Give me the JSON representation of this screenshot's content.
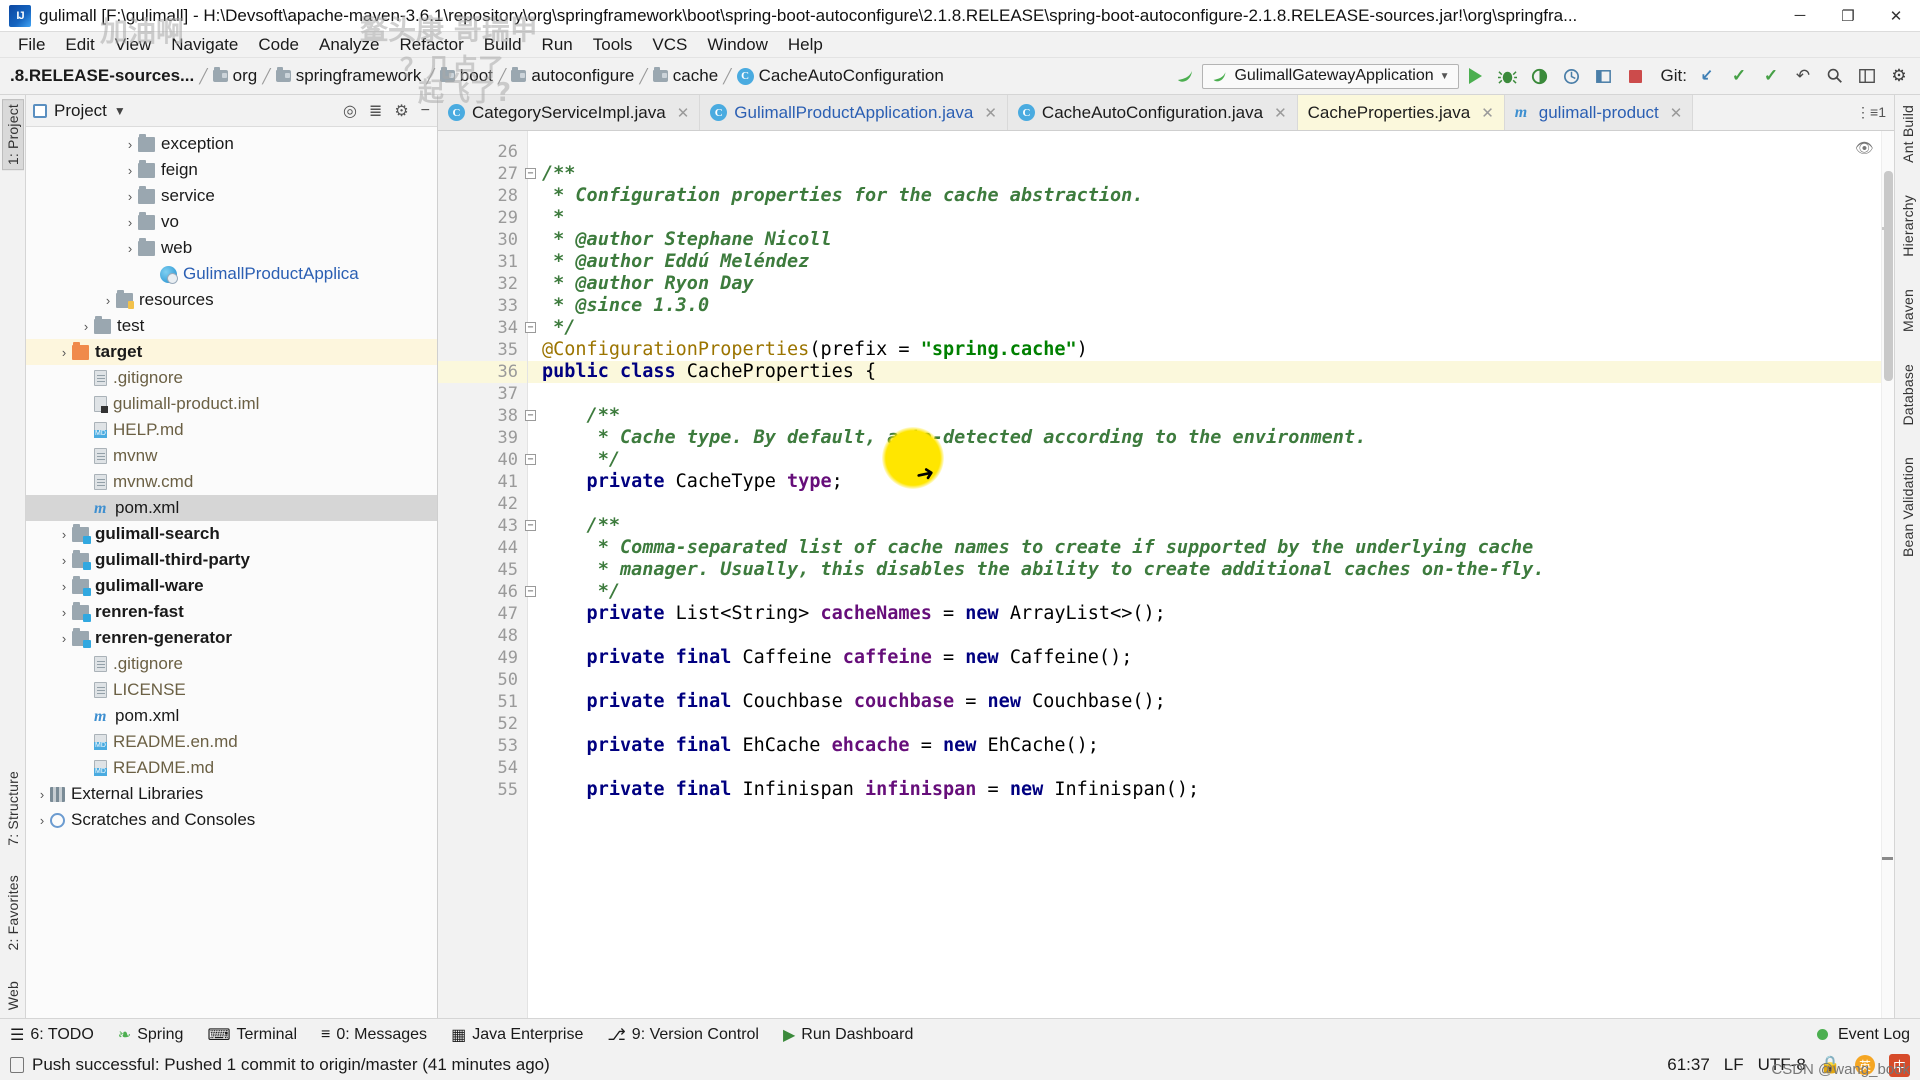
{
  "window": {
    "title": "gulimall [F:\\gulimall] - H:\\Devsoft\\apache-maven-3.6.1\\repository\\org\\springframework\\boot\\spring-boot-autoconfigure\\2.1.8.RELEASE\\spring-boot-autoconfigure-2.1.8.RELEASE-sources.jar!\\org\\springfra...",
    "logo": "IJ",
    "minimize": "─",
    "maximize": "❐",
    "close": "✕"
  },
  "menu": {
    "items": [
      "File",
      "Edit",
      "View",
      "Navigate",
      "Code",
      "Analyze",
      "Refactor",
      "Build",
      "Run",
      "Tools",
      "VCS",
      "Window",
      "Help"
    ]
  },
  "navbar": {
    "breadcrumbs": [
      {
        "label": ".8.RELEASE-sources...",
        "icon": "jar-icon",
        "type": "text"
      },
      {
        "label": "org",
        "icon": "folder-icon",
        "type": "folder"
      },
      {
        "label": "springframework",
        "icon": "folder-icon",
        "type": "folder"
      },
      {
        "label": "boot",
        "icon": "folder-icon",
        "type": "folder"
      },
      {
        "label": "autoconfigure",
        "icon": "folder-icon",
        "type": "folder"
      },
      {
        "label": "cache",
        "icon": "folder-icon",
        "type": "folder"
      },
      {
        "label": "CacheAutoConfiguration",
        "icon": "class-icon",
        "type": "class"
      }
    ],
    "run_config": "GulimallGatewayApplication",
    "run_config_icon": "spring-boot-icon",
    "dropdown_arrow": "▼",
    "buttons": [
      {
        "name": "run-button",
        "glyph": "▶"
      },
      {
        "name": "debug-button",
        "glyph": "🐞"
      },
      {
        "name": "run-with-coverage-button",
        "glyph": "◐"
      },
      {
        "name": "profile-button",
        "glyph": "⦿"
      },
      {
        "name": "attach-debugger-button",
        "glyph": "▤"
      },
      {
        "name": "stop-button",
        "glyph": "■"
      }
    ],
    "git_label": "Git:",
    "git_buttons": [
      {
        "name": "update-project-icon",
        "glyph": "↙"
      },
      {
        "name": "commit-icon",
        "glyph": "✓"
      },
      {
        "name": "push-icon",
        "glyph": "↗"
      },
      {
        "name": "history-icon",
        "glyph": "↺"
      },
      {
        "name": "search-everywhere-icon",
        "glyph": "⌕"
      },
      {
        "name": "settings-icon",
        "glyph": "⚙"
      },
      {
        "name": "project-structure-icon",
        "glyph": "▣"
      }
    ]
  },
  "left_rail": {
    "top": [
      {
        "label": "1: Project",
        "active": true
      }
    ],
    "bottom": [
      {
        "label": "7: Structure"
      },
      {
        "label": "2: Favorites"
      },
      {
        "label": "Web"
      }
    ]
  },
  "right_rail": {
    "items": [
      "Ant Build",
      "Hierarchy",
      "Maven",
      "Database",
      "Bean Validation"
    ]
  },
  "project_panel": {
    "title": "Project",
    "dropdown": "▼",
    "icons": [
      "target-icon",
      "collapse-all-icon",
      "settings-icon",
      "hide-icon"
    ],
    "tree": [
      {
        "depth": 4,
        "arrow": "›",
        "icon": "folder",
        "label": "exception",
        "style": ""
      },
      {
        "depth": 4,
        "arrow": "›",
        "icon": "folder",
        "label": "feign",
        "style": ""
      },
      {
        "depth": 4,
        "arrow": "›",
        "icon": "folder",
        "label": "service",
        "style": ""
      },
      {
        "depth": 4,
        "arrow": "›",
        "icon": "folder",
        "label": "vo",
        "style": ""
      },
      {
        "depth": 4,
        "arrow": "›",
        "icon": "folder",
        "label": "web",
        "style": ""
      },
      {
        "depth": 5,
        "arrow": "",
        "icon": "spring",
        "label": "GulimallProductApplica",
        "style": "blue"
      },
      {
        "depth": 3,
        "arrow": "›",
        "icon": "folder-res",
        "label": "resources",
        "style": ""
      },
      {
        "depth": 2,
        "arrow": "›",
        "icon": "folder",
        "label": "test",
        "style": ""
      },
      {
        "depth": 1,
        "arrow": "›",
        "icon": "folder-orange",
        "label": "target",
        "style": "bold",
        "row": "sel-target"
      },
      {
        "depth": 2,
        "arrow": "",
        "icon": "file",
        "label": ".gitignore",
        "style": "tan"
      },
      {
        "depth": 2,
        "arrow": "",
        "icon": "iml",
        "label": "gulimall-product.iml",
        "style": "tan"
      },
      {
        "depth": 2,
        "arrow": "",
        "icon": "md",
        "label": "HELP.md",
        "style": "tan"
      },
      {
        "depth": 2,
        "arrow": "",
        "icon": "file",
        "label": "mvnw",
        "style": "tan"
      },
      {
        "depth": 2,
        "arrow": "",
        "icon": "file",
        "label": "mvnw.cmd",
        "style": "tan"
      },
      {
        "depth": 2,
        "arrow": "",
        "icon": "xmlm",
        "label": "pom.xml",
        "style": "",
        "row": "sel-pom"
      },
      {
        "depth": 1,
        "arrow": "›",
        "icon": "folder-mod",
        "label": "gulimall-search",
        "style": "bold"
      },
      {
        "depth": 1,
        "arrow": "›",
        "icon": "folder-mod",
        "label": "gulimall-third-party",
        "style": "bold"
      },
      {
        "depth": 1,
        "arrow": "›",
        "icon": "folder-mod",
        "label": "gulimall-ware",
        "style": "bold"
      },
      {
        "depth": 1,
        "arrow": "›",
        "icon": "folder-mod",
        "label": "renren-fast",
        "style": "bold"
      },
      {
        "depth": 1,
        "arrow": "›",
        "icon": "folder-mod",
        "label": "renren-generator",
        "style": "bold"
      },
      {
        "depth": 2,
        "arrow": "",
        "icon": "file",
        "label": ".gitignore",
        "style": "tan"
      },
      {
        "depth": 2,
        "arrow": "",
        "icon": "file",
        "label": "LICENSE",
        "style": "tan"
      },
      {
        "depth": 2,
        "arrow": "",
        "icon": "xmlm",
        "label": "pom.xml",
        "style": ""
      },
      {
        "depth": 2,
        "arrow": "",
        "icon": "md",
        "label": "README.en.md",
        "style": "tan"
      },
      {
        "depth": 2,
        "arrow": "",
        "icon": "md",
        "label": "README.md",
        "style": "tan"
      },
      {
        "depth": 0,
        "arrow": "›",
        "icon": "lib",
        "label": "External Libraries",
        "style": ""
      },
      {
        "depth": 0,
        "arrow": "›",
        "icon": "scratch",
        "label": "Scratches and Consoles",
        "style": ""
      }
    ]
  },
  "editor": {
    "tabs": [
      {
        "label": "CategoryServiceImpl.java",
        "icon": "class-icon",
        "active": false,
        "modified": false,
        "closable": true
      },
      {
        "label": "GulimallProductApplication.java",
        "icon": "spring-class-icon",
        "active": false,
        "modified": true,
        "closable": true
      },
      {
        "label": "CacheAutoConfiguration.java",
        "icon": "class-icon",
        "active": false,
        "modified": false,
        "closable": true
      },
      {
        "label": "CacheProperties.java",
        "icon": "",
        "active": true,
        "modified": false,
        "closable": true
      },
      {
        "label": "gulimall-product",
        "icon": "module-icon",
        "active": false,
        "modified": true,
        "closable": true
      }
    ],
    "tab_overflow": "⋮≡1",
    "first_line_number": 26,
    "highlighted_line": 36,
    "lines": [
      {
        "n": 26,
        "fold": "",
        "segs": []
      },
      {
        "n": 27,
        "fold": "−",
        "segs": [
          {
            "t": "/**",
            "c": "cmb"
          }
        ]
      },
      {
        "n": 28,
        "fold": "",
        "segs": [
          {
            "t": " * Configuration properties for the cache abstraction.",
            "c": "cmb"
          }
        ]
      },
      {
        "n": 29,
        "fold": "",
        "segs": [
          {
            "t": " *",
            "c": "cmb"
          }
        ]
      },
      {
        "n": 30,
        "fold": "",
        "segs": [
          {
            "t": " * ",
            "c": "cmb"
          },
          {
            "t": "@author",
            "c": "tag"
          },
          {
            "t": " Stephane Nicoll",
            "c": "cmb"
          }
        ]
      },
      {
        "n": 31,
        "fold": "",
        "segs": [
          {
            "t": " * ",
            "c": "cmb"
          },
          {
            "t": "@author",
            "c": "tag"
          },
          {
            "t": " Eddú Meléndez",
            "c": "cmb"
          }
        ]
      },
      {
        "n": 32,
        "fold": "",
        "segs": [
          {
            "t": " * ",
            "c": "cmb"
          },
          {
            "t": "@author",
            "c": "tag"
          },
          {
            "t": " Ryon Day",
            "c": "cmb"
          }
        ]
      },
      {
        "n": 33,
        "fold": "",
        "segs": [
          {
            "t": " * ",
            "c": "cmb"
          },
          {
            "t": "@since",
            "c": "tag"
          },
          {
            "t": " 1.3.0",
            "c": "cmb"
          }
        ]
      },
      {
        "n": 34,
        "fold": "−",
        "segs": [
          {
            "t": " */",
            "c": "cmb"
          }
        ]
      },
      {
        "n": 35,
        "fold": "",
        "segs": [
          {
            "t": "@ConfigurationProperties",
            "c": "ann"
          },
          {
            "t": "(prefix = ",
            "c": "typ"
          },
          {
            "t": "\"spring.cache\"",
            "c": "str"
          },
          {
            "t": ")",
            "c": "typ"
          }
        ]
      },
      {
        "n": 36,
        "fold": "",
        "mark": "spring",
        "hl": true,
        "segs": [
          {
            "t": "public class ",
            "c": "kw"
          },
          {
            "t": "CacheProperties {",
            "c": "typ"
          }
        ]
      },
      {
        "n": 37,
        "fold": "",
        "segs": []
      },
      {
        "n": 38,
        "fold": "−",
        "segs": [
          {
            "t": "    /**",
            "c": "cmb"
          }
        ]
      },
      {
        "n": 39,
        "fold": "",
        "segs": [
          {
            "t": "     * Cache type. By default, auto-detected according to the environment.",
            "c": "cmb"
          }
        ]
      },
      {
        "n": 40,
        "fold": "−",
        "segs": [
          {
            "t": "     */",
            "c": "cmb"
          }
        ]
      },
      {
        "n": 41,
        "fold": "",
        "segs": [
          {
            "t": "    private ",
            "c": "kw"
          },
          {
            "t": "CacheType ",
            "c": "typ"
          },
          {
            "t": "type",
            "c": "fld"
          },
          {
            "t": ";",
            "c": "typ"
          }
        ]
      },
      {
        "n": 42,
        "fold": "",
        "segs": []
      },
      {
        "n": 43,
        "fold": "−",
        "segs": [
          {
            "t": "    /**",
            "c": "cmb"
          }
        ]
      },
      {
        "n": 44,
        "fold": "",
        "segs": [
          {
            "t": "     * Comma-separated list of cache names to create if supported by the underlying cache",
            "c": "cmb"
          }
        ]
      },
      {
        "n": 45,
        "fold": "",
        "segs": [
          {
            "t": "     * manager. Usually, this disables the ability to create additional caches on-the-fly.",
            "c": "cmb"
          }
        ]
      },
      {
        "n": 46,
        "fold": "−",
        "segs": [
          {
            "t": "     */",
            "c": "cmb"
          }
        ]
      },
      {
        "n": 47,
        "fold": "",
        "segs": [
          {
            "t": "    private ",
            "c": "kw"
          },
          {
            "t": "List<String> ",
            "c": "typ"
          },
          {
            "t": "cacheNames",
            "c": "fld"
          },
          {
            "t": " = ",
            "c": "typ"
          },
          {
            "t": "new ",
            "c": "kw"
          },
          {
            "t": "ArrayList<>();",
            "c": "typ"
          }
        ]
      },
      {
        "n": 48,
        "fold": "",
        "segs": []
      },
      {
        "n": 49,
        "fold": "",
        "segs": [
          {
            "t": "    private final ",
            "c": "kw"
          },
          {
            "t": "Caffeine ",
            "c": "typ"
          },
          {
            "t": "caffeine",
            "c": "fld"
          },
          {
            "t": " = ",
            "c": "typ"
          },
          {
            "t": "new ",
            "c": "kw"
          },
          {
            "t": "Caffeine();",
            "c": "typ"
          }
        ]
      },
      {
        "n": 50,
        "fold": "",
        "segs": []
      },
      {
        "n": 51,
        "fold": "",
        "segs": [
          {
            "t": "    private final ",
            "c": "kw"
          },
          {
            "t": "Couchbase ",
            "c": "typ"
          },
          {
            "t": "couchbase",
            "c": "fld"
          },
          {
            "t": " = ",
            "c": "typ"
          },
          {
            "t": "new ",
            "c": "kw"
          },
          {
            "t": "Couchbase();",
            "c": "typ"
          }
        ]
      },
      {
        "n": 52,
        "fold": "",
        "segs": []
      },
      {
        "n": 53,
        "fold": "",
        "segs": [
          {
            "t": "    private final ",
            "c": "kw"
          },
          {
            "t": "EhCache ",
            "c": "typ"
          },
          {
            "t": "ehcache",
            "c": "fld"
          },
          {
            "t": " = ",
            "c": "typ"
          },
          {
            "t": "new ",
            "c": "kw"
          },
          {
            "t": "EhCache();",
            "c": "typ"
          }
        ]
      },
      {
        "n": 54,
        "fold": "",
        "segs": []
      },
      {
        "n": 55,
        "fold": "",
        "segs": [
          {
            "t": "    private final ",
            "c": "kw"
          },
          {
            "t": "Infinispan ",
            "c": "typ"
          },
          {
            "t": "infinispan",
            "c": "fld"
          },
          {
            "t": " = ",
            "c": "typ"
          },
          {
            "t": "new ",
            "c": "kw"
          },
          {
            "t": "Infinispan();",
            "c": "typ"
          }
        ]
      }
    ]
  },
  "bottom_tools": [
    {
      "label": "6: TODO",
      "icon": "todo-icon"
    },
    {
      "label": "Spring",
      "icon": "spring-leaf-icon"
    },
    {
      "label": "Terminal",
      "icon": "terminal-icon"
    },
    {
      "label": "0: Messages",
      "icon": "messages-icon"
    },
    {
      "label": "Java Enterprise",
      "icon": "java-enterprise-icon"
    },
    {
      "label": "9: Version Control",
      "icon": "version-control-icon"
    },
    {
      "label": "Run Dashboard",
      "icon": "run-dashboard-icon"
    }
  ],
  "event_log": {
    "label": "Event Log",
    "icon": "event-log-icon"
  },
  "status": {
    "message": "Push successful: Pushed 1 commit to origin/master (41 minutes ago)",
    "caret": "61:37",
    "line_sep": "LF",
    "encoding": "UTF-8",
    "ime_lang": "英",
    "ime_mode": "中",
    "lock_icon": "🔒",
    "watermark": "CSDN @wang_book"
  },
  "overlay_text": {
    "a": "加油啊",
    "b": "鳌头康 哥瑞甲",
    "c": "？几点了",
    "d": "起飞了?"
  }
}
